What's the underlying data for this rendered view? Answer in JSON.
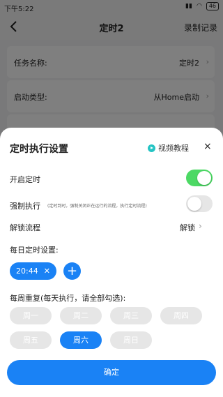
{
  "status_bar": {
    "time": "下午5:22",
    "battery": "46"
  },
  "nav": {
    "title": "定时2",
    "right_action": "录制记录"
  },
  "background": {
    "task_name_label": "任务名称:",
    "task_name_value": "定时2",
    "start_type_label": "启动类型:",
    "start_type_value": "从Home启动"
  },
  "sheet": {
    "title": "定时执行设置",
    "tutorial_label": "视频教程",
    "close_symbol": "×",
    "enable_timer_label": "开启定时",
    "enable_timer_on": true,
    "force_run_label": "强制执行",
    "force_run_hint": "(定时到时，强制关闭正在运行的流程，执行定时流程)",
    "force_run_on": false,
    "unlock_label": "解锁流程",
    "unlock_value": "解锁",
    "daily_label": "每日定时设置:",
    "times": [
      "20:44"
    ],
    "weekly_label": "每周重复(每天执行，请全部勾选):",
    "days": [
      {
        "label": "周一",
        "selected": false
      },
      {
        "label": "周二",
        "selected": false
      },
      {
        "label": "周三",
        "selected": false
      },
      {
        "label": "周四",
        "selected": false
      },
      {
        "label": "周五",
        "selected": false
      },
      {
        "label": "周六",
        "selected": true
      },
      {
        "label": "周日",
        "selected": false
      }
    ],
    "confirm_label": "确定"
  },
  "colors": {
    "primary": "#1a82f5",
    "toggle_on": "#4cd964",
    "chip_off": "#e6e6e6"
  }
}
